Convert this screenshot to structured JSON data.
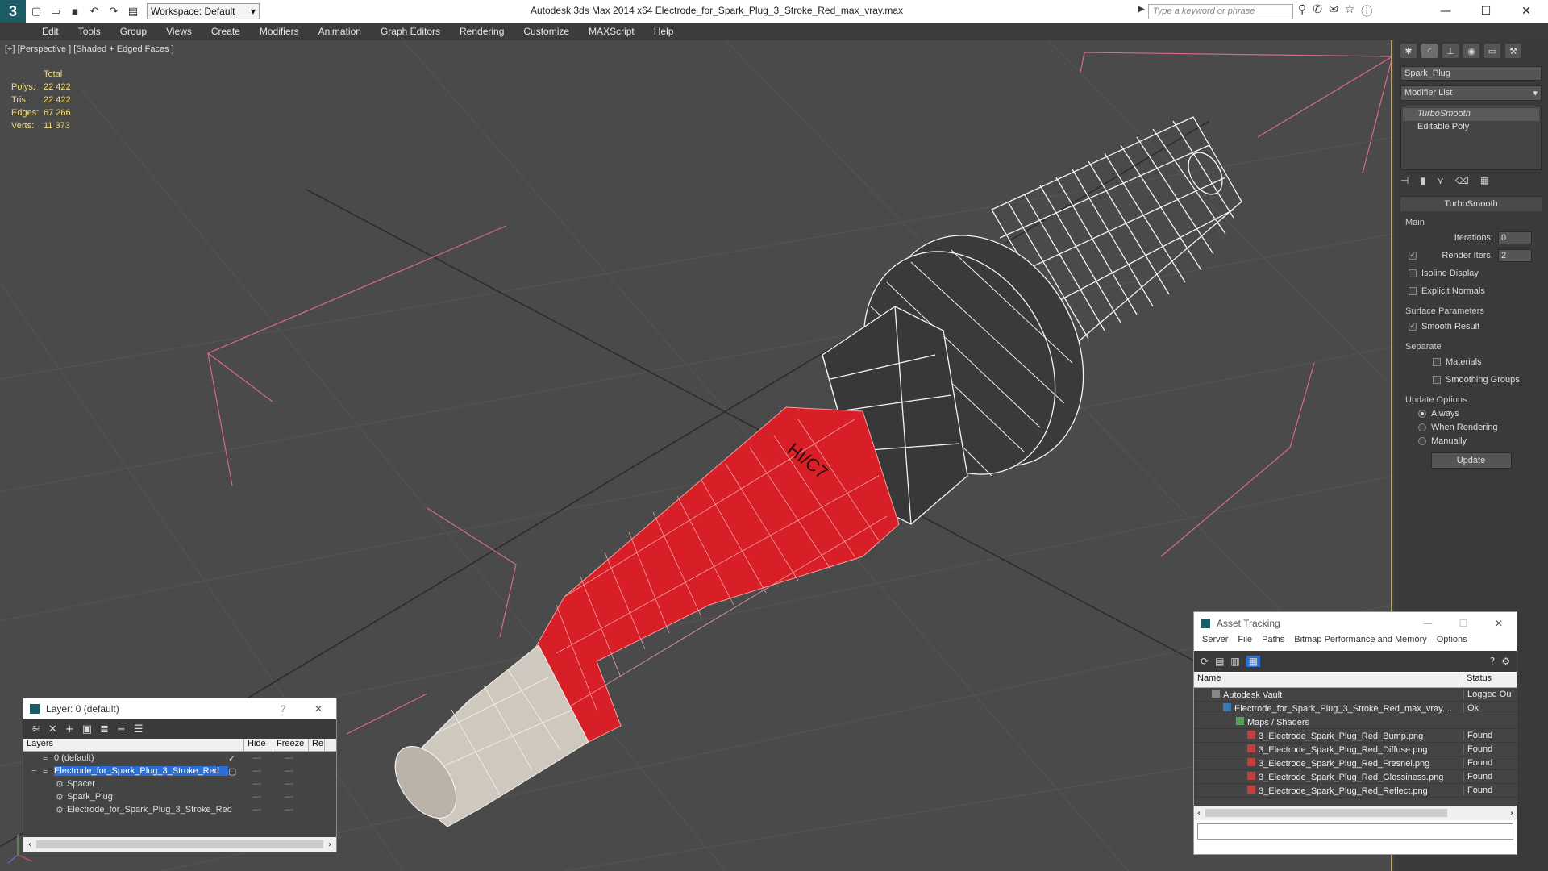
{
  "title_bar": {
    "app_logo_icon": "3ds-max-logo-icon",
    "workspace_label": "Workspace: Default",
    "window_title": "Autodesk 3ds Max  2014 x64        Electrode_for_Spark_Plug_3_Stroke_Red_max_vray.max",
    "search_placeholder": "Type a keyword or phrase"
  },
  "menu": [
    "Edit",
    "Tools",
    "Group",
    "Views",
    "Create",
    "Modifiers",
    "Animation",
    "Graph Editors",
    "Rendering",
    "Customize",
    "MAXScript",
    "Help"
  ],
  "viewport": {
    "label": "[+] [Perspective ] [Shaded + Edged Faces ]",
    "stats_header": "Total",
    "stats": [
      {
        "key": "Polys:",
        "value": "22 422"
      },
      {
        "key": "Tris:",
        "value": "22 422"
      },
      {
        "key": "Edges:",
        "value": "67 266"
      },
      {
        "key": "Verts:",
        "value": "11 373"
      }
    ],
    "label_on_model": "HI/C7"
  },
  "command_panel": {
    "object_name": "Spark_Plug",
    "modifier_list": "Modifier List",
    "stack": [
      "TurboSmooth",
      "Editable Poly"
    ],
    "rollout_title": "TurboSmooth",
    "main_group": "Main",
    "iterations_label": "Iterations:",
    "iterations_value": "0",
    "render_iters_label": "Render Iters:",
    "render_iters_value": "2",
    "isoline_label": "Isoline Display",
    "explicit_normals_label": "Explicit Normals",
    "surface_group": "Surface Parameters",
    "smooth_result_label": "Smooth Result",
    "separate_label": "Separate",
    "materials_label": "Materials",
    "smoothing_groups_label": "Smoothing Groups",
    "update_group": "Update Options",
    "always_label": "Always",
    "when_rendering_label": "When Rendering",
    "manually_label": "Manually",
    "update_button": "Update"
  },
  "layer_window": {
    "title": "Layer: 0 (default)",
    "help": "?",
    "close": "✕",
    "columns": [
      "Layers",
      "Hide",
      "Freeze",
      "Re"
    ],
    "rows": [
      {
        "name": "0 (default)",
        "indent": 1,
        "selected": false
      },
      {
        "name": "Electrode_for_Spark_Plug_3_Stroke_Red",
        "indent": 1,
        "selected": true
      },
      {
        "name": "Spacer",
        "indent": 2,
        "selected": false
      },
      {
        "name": "Spark_Plug",
        "indent": 2,
        "selected": false
      },
      {
        "name": "Electrode_for_Spark_Plug_3_Stroke_Red",
        "indent": 2,
        "selected": false
      }
    ]
  },
  "asset_window": {
    "title": "Asset Tracking",
    "menu": [
      "Server",
      "File",
      "Paths",
      "Bitmap Performance and Memory",
      "Options"
    ],
    "columns": [
      "Name",
      "Status"
    ],
    "rows": [
      {
        "name": "Autodesk Vault",
        "status": "Logged Ou",
        "indent": 1
      },
      {
        "name": "Electrode_for_Spark_Plug_3_Stroke_Red_max_vray....",
        "status": "Ok",
        "indent": 2
      },
      {
        "name": "Maps / Shaders",
        "status": "",
        "indent": 3
      },
      {
        "name": "3_Electrode_Spark_Plug_Red_Bump.png",
        "status": "Found",
        "indent": 4
      },
      {
        "name": "3_Electrode_Spark_Plug_Red_Diffuse.png",
        "status": "Found",
        "indent": 4
      },
      {
        "name": "3_Electrode_Spark_Plug_Red_Fresnel.png",
        "status": "Found",
        "indent": 4
      },
      {
        "name": "3_Electrode_Spark_Plug_Red_Glossiness.png",
        "status": "Found",
        "indent": 4
      },
      {
        "name": "3_Electrode_Spark_Plug_Red_Reflect.png",
        "status": "Found",
        "indent": 4
      }
    ]
  },
  "colors": {
    "viewport_bg": "#4a4a4a",
    "stats_text": "#f0dc7a",
    "model_red": "#d81e26",
    "selection_blue": "#2a6fd8"
  }
}
